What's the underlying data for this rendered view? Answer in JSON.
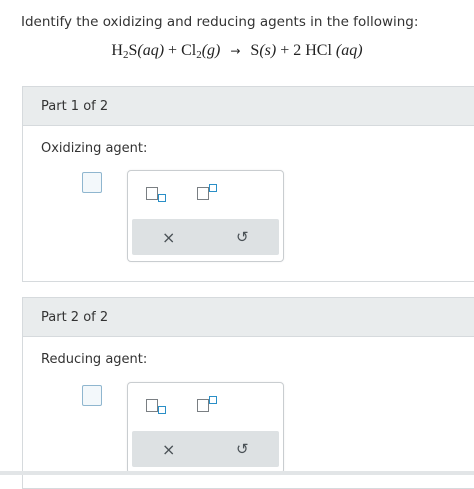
{
  "question": {
    "prompt": "Identify the oxidizing and reducing agents in the following:"
  },
  "equation": {
    "r1_base": "H",
    "r1_sub": "2",
    "r1_rest": "S",
    "r1_state": "(aq)",
    "plus1": "+",
    "r2_base": "Cl",
    "r2_sub": "2",
    "r2_state": "(g)",
    "arrow": "→",
    "p1_base": "S",
    "p1_state": "(s)",
    "plus2": "+",
    "p2_base": "2 HCl",
    "p2_state": "(aq)"
  },
  "parts": [
    {
      "header": "Part 1 of 2",
      "label": "Oxidizing agent:",
      "value": "",
      "clear_icon": "×",
      "undo_icon": "↺"
    },
    {
      "header": "Part 2 of 2",
      "label": "Reducing agent:",
      "value": "",
      "clear_icon": "×",
      "undo_icon": "↺"
    }
  ],
  "icons": {
    "subscript": "subscript-template-icon",
    "superscript": "superscript-template-icon",
    "clear": "x-icon",
    "undo": "undo-icon"
  },
  "colors": {
    "header_bg": "#e9eced",
    "answer_border": "#8fb6cf",
    "accent_blue": "#2a8fc7"
  }
}
